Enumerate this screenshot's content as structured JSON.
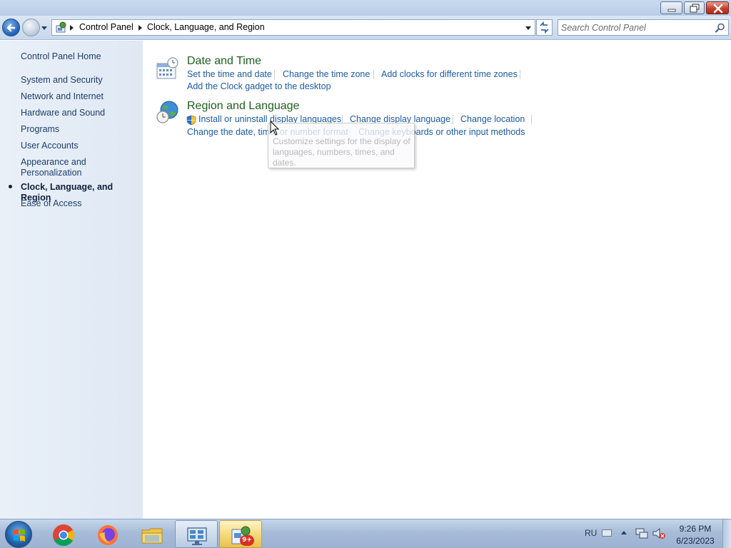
{
  "window": {
    "caption_buttons": [
      "minimize",
      "maximize",
      "close"
    ]
  },
  "address": {
    "breadcrumbs": [
      "Control Panel",
      "Clock, Language, and Region"
    ]
  },
  "search": {
    "placeholder": "Search Control Panel"
  },
  "sidebar": {
    "home_label": "Control Panel Home",
    "items": [
      {
        "label": "System and Security",
        "current": false
      },
      {
        "label": "Network and Internet",
        "current": false
      },
      {
        "label": "Hardware and Sound",
        "current": false
      },
      {
        "label": "Programs",
        "current": false
      },
      {
        "label": "User Accounts",
        "current": false
      },
      {
        "label": "Appearance and Personalization",
        "current": false
      },
      {
        "label": "Clock, Language, and Region",
        "current": true
      },
      {
        "label": "Ease of Access",
        "current": false
      }
    ]
  },
  "categories": [
    {
      "title": "Date and Time",
      "icon": "calendar-clock-icon",
      "tasks": [
        "Set the time and date",
        "Change the time zone",
        "Add clocks for different time zones",
        "Add the Clock gadget to the desktop"
      ]
    },
    {
      "title": "Region and Language",
      "icon": "globe-clock-icon",
      "tasks": [
        "Install or uninstall display languages",
        "Change display language",
        "Change location",
        "Change the date, time, or number format",
        "Change keyboards or other input methods"
      ]
    }
  ],
  "tooltip": {
    "text": "Customize settings for the display of languages, numbers, times, and dates."
  },
  "taskbar": {
    "pinned": [
      "start-orb",
      "chrome-icon",
      "firefox-icon",
      "file-explorer-icon",
      "remote-desktop-icon",
      "control-panel-icon"
    ],
    "badge": "9+",
    "language": "RU",
    "time": "9:26 PM",
    "date": "6/23/2023"
  },
  "colors": {
    "link": "#1c5ba6",
    "category_title": "#1e5f1e",
    "sidebar_bg": "#e4edf7"
  }
}
